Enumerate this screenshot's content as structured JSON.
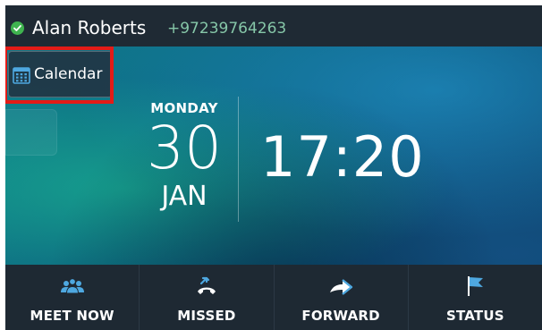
{
  "header": {
    "user_name": "Alan Roberts",
    "phone_number": "+97239764263",
    "presence_status_color": "#3fb34f"
  },
  "side_panel": {
    "calendar_label": "Calendar",
    "calendar_icon": "calendar-icon"
  },
  "clock": {
    "day_name": "MONDAY",
    "day_number": "30",
    "month": "JAN",
    "time": "17:20"
  },
  "bottom_bar": {
    "items": [
      {
        "label": "MEET NOW",
        "icon": "people-icon"
      },
      {
        "label": "MISSED",
        "icon": "missed-call-icon"
      },
      {
        "label": "FORWARD",
        "icon": "forward-arrow-icon"
      },
      {
        "label": "STATUS",
        "icon": "flag-icon"
      }
    ]
  },
  "colors": {
    "accent_icon": "#4ea8e0",
    "highlight_frame": "#e41b17",
    "phone_text": "#86c7a8"
  }
}
